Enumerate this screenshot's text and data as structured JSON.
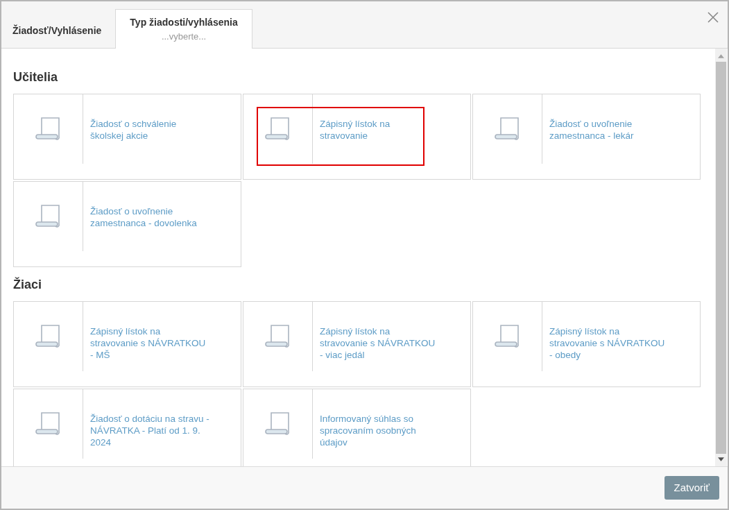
{
  "tabs": [
    {
      "label": "Žiadosť/Vyhlásenie",
      "selected": false
    },
    {
      "label": "Typ žiadosti/vyhlásenia",
      "subtitle": "...vyberte...",
      "selected": true
    }
  ],
  "sections": [
    {
      "title": "Učitelia",
      "items": [
        {
          "label": "Žiadosť o schválenie školskej akcie",
          "highlighted": false
        },
        {
          "label": "Zápisný lístok na stravovanie",
          "highlighted": true
        },
        {
          "label": "Žiadosť o uvoľnenie zamestnanca - lekár",
          "highlighted": false
        },
        {
          "label": "Žiadosť o uvoľnenie zamestnanca - dovolenka",
          "highlighted": false
        }
      ]
    },
    {
      "title": "Žiaci",
      "items": [
        {
          "label": "Zápisný lístok na stravovanie s NÁVRATKOU - MŠ",
          "highlighted": false
        },
        {
          "label": "Zápisný lístok na stravovanie s NÁVRATKOU - viac jedál",
          "highlighted": false
        },
        {
          "label": "Zápisný lístok na stravovanie s NÁVRATKOU - obedy",
          "highlighted": false
        },
        {
          "label": "Žiadosť o dotáciu na stravu - NÁVRATKA - Platí od 1. 9. 2024",
          "highlighted": false
        },
        {
          "label": "Informovaný súhlas so spracovaním osobných údajov",
          "highlighted": false
        }
      ]
    }
  ],
  "footer": {
    "close_button": "Zatvoriť"
  }
}
